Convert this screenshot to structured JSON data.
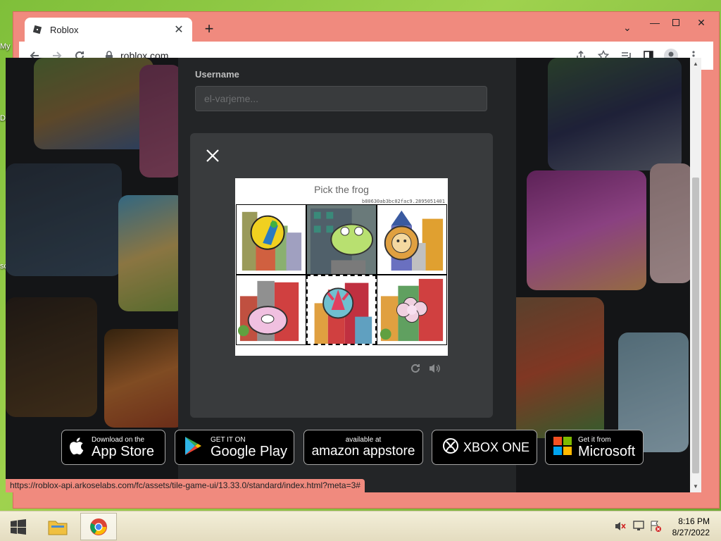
{
  "desktop": {
    "fragments": [
      "My",
      "Da",
      "sc"
    ]
  },
  "browser": {
    "tab_title": "Roblox",
    "url": "roblox.com",
    "status_url": "https://roblox-api.arkoselabs.com/fc/assets/tile-game-ui/13.33.0/standard/index.html?meta=3#"
  },
  "login": {
    "username_label": "Username",
    "username_placeholder": "el-varjeme..."
  },
  "captcha": {
    "prompt": "Pick the frog",
    "session_id": "b80630ab3bc02fac9.2895051401",
    "tiles": [
      {
        "subject": "parrot"
      },
      {
        "subject": "frog"
      },
      {
        "subject": "lion"
      },
      {
        "subject": "donut"
      },
      {
        "subject": "lobster",
        "selected": true
      },
      {
        "subject": "flower"
      }
    ]
  },
  "stores": {
    "apple": {
      "small": "Download on the",
      "big": "App Store"
    },
    "google": {
      "small": "GET IT ON",
      "big": "Google Play"
    },
    "amazon": {
      "small": "available at",
      "big": "amazon appstore"
    },
    "xbox": {
      "big": "XBOX ONE"
    },
    "microsoft": {
      "small": "Get it from",
      "big": "Microsoft"
    }
  },
  "taskbar": {
    "time": "8:16 PM",
    "date": "8/27/2022"
  },
  "colors": {
    "window_frame": "#f08a7e",
    "page_bg": "#232527",
    "modal_bg": "#393b3d"
  }
}
